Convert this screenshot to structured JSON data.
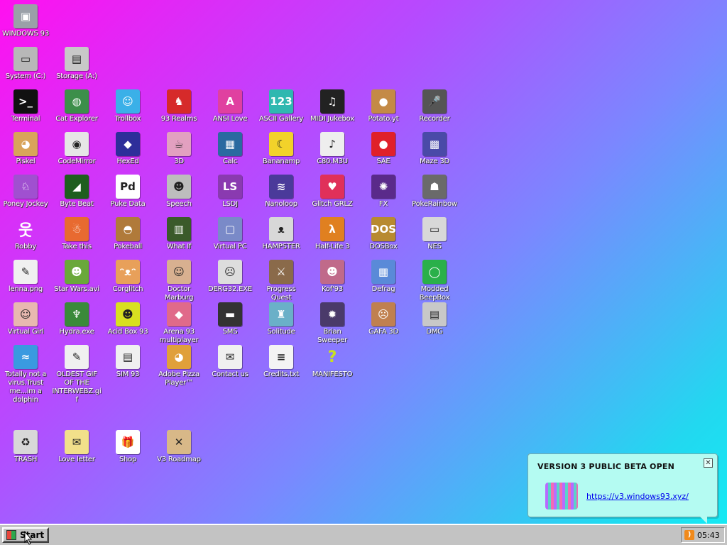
{
  "desktop": {
    "icons": [
      {
        "label": "WINDOWS 93",
        "glyph": "monitor-icon",
        "symbol": "▣",
        "color": "#9aa0a8",
        "interactive": true
      },
      {
        "label": "System (C:)",
        "glyph": "drive-c-icon",
        "symbol": "▭",
        "color": "#b8b8b8",
        "interactive": true
      },
      {
        "label": "Storage (A:)",
        "glyph": "floppy-drive-icon",
        "symbol": "▤",
        "color": "#c8c8c8",
        "interactive": true
      },
      {
        "label": "Terminal",
        "glyph": "terminal-icon",
        "symbol": ">_",
        "color": "#111111",
        "interactive": true
      },
      {
        "label": "Cat Explorer",
        "glyph": "cat-globe-icon",
        "symbol": "◍",
        "color": "#3c8f4a",
        "interactive": true
      },
      {
        "label": "Trollbox",
        "glyph": "chat-bubble-icon",
        "symbol": "☺",
        "color": "#3ab0e8",
        "interactive": true
      },
      {
        "label": "93 Realms",
        "glyph": "realms-icon",
        "symbol": "♞",
        "color": "#d62a2a",
        "interactive": true
      },
      {
        "label": "ANSI Love",
        "glyph": "ansi-love-icon",
        "symbol": "A",
        "color": "#e040a0",
        "interactive": true
      },
      {
        "label": "ASCII Gallery",
        "glyph": "ascii-gallery-icon",
        "symbol": "123",
        "color": "#2fb8b0",
        "interactive": true
      },
      {
        "label": "MIDI Jukebox",
        "glyph": "piano-keys-icon",
        "symbol": "♫",
        "color": "#222222",
        "interactive": true
      },
      {
        "label": "Potato.yt",
        "glyph": "potato-icon",
        "symbol": "●",
        "color": "#c48a46",
        "interactive": true
      },
      {
        "label": "Recorder",
        "glyph": "microphone-icon",
        "symbol": "🎤",
        "color": "#555555",
        "interactive": true
      },
      {
        "label": "Piskel",
        "glyph": "palette-icon",
        "symbol": "◕",
        "color": "#d9a45a",
        "interactive": true
      },
      {
        "label": "CodeMirror",
        "glyph": "codemirror-icon",
        "symbol": "◉",
        "color": "#e6e6e6",
        "interactive": true
      },
      {
        "label": "HexEd",
        "glyph": "hex-cube-icon",
        "symbol": "◆",
        "color": "#2e2e9a",
        "interactive": true
      },
      {
        "label": "3D",
        "glyph": "teapot-icon",
        "symbol": "☕",
        "color": "#e2a0c0",
        "interactive": true
      },
      {
        "label": "Calc",
        "glyph": "calculator-icon",
        "symbol": "▦",
        "color": "#2a6aa0",
        "interactive": true
      },
      {
        "label": "Bananamp",
        "glyph": "banana-icon",
        "symbol": "☾",
        "color": "#f2d22a",
        "interactive": true
      },
      {
        "label": "C80.M3U",
        "glyph": "audio-file-icon",
        "symbol": "♪",
        "color": "#eeeeee",
        "interactive": true
      },
      {
        "label": "SAE",
        "glyph": "amiga-ball-icon",
        "symbol": "●",
        "color": "#e0202a",
        "interactive": true
      },
      {
        "label": "Maze 3D",
        "glyph": "maze-icon",
        "symbol": "▩",
        "color": "#4a4aa8",
        "interactive": true
      },
      {
        "label": "Poney Jockey",
        "glyph": "pony-icon",
        "symbol": "♘",
        "color": "#a050d0",
        "interactive": true
      },
      {
        "label": "Byte Beat",
        "glyph": "bytebeat-icon",
        "symbol": "◢",
        "color": "#1e5e1e",
        "interactive": true
      },
      {
        "label": "Puke Data",
        "glyph": "puredata-icon",
        "symbol": "Pd",
        "color": "#ffffff",
        "interactive": true
      },
      {
        "label": "Speech",
        "glyph": "speech-face-icon",
        "symbol": "☻",
        "color": "#bdbdbd",
        "interactive": true
      },
      {
        "label": "LSDJ",
        "glyph": "lsdj-icon",
        "symbol": "LS",
        "color": "#8a3ab0",
        "interactive": true
      },
      {
        "label": "Nanoloop",
        "glyph": "nanoloop-icon",
        "symbol": "≋",
        "color": "#4a3a9a",
        "interactive": true
      },
      {
        "label": "Glitch GRLZ",
        "glyph": "lips-icon",
        "symbol": "♥",
        "color": "#e0305a",
        "interactive": true
      },
      {
        "label": "FX",
        "glyph": "atom-icon",
        "symbol": "✺",
        "color": "#5a2a8a",
        "interactive": true
      },
      {
        "label": "PokeRainbow",
        "glyph": "poke-rainbow-icon",
        "symbol": "☗",
        "color": "#6a6a6a",
        "interactive": true
      },
      {
        "label": "Robby",
        "glyph": "stick-figure-icon",
        "symbol": "웃",
        "color": "transparent",
        "interactive": true
      },
      {
        "label": "Take this",
        "glyph": "old-man-icon",
        "symbol": "☃",
        "color": "#e86a30",
        "interactive": true
      },
      {
        "label": "Pokeball",
        "glyph": "pokeball-icon",
        "symbol": "◓",
        "color": "#b07a3a",
        "interactive": true
      },
      {
        "label": "What If",
        "glyph": "what-if-icon",
        "symbol": "▥",
        "color": "#3a5a2a",
        "interactive": true
      },
      {
        "label": "Virtual PC",
        "glyph": "virtual-pc-icon",
        "symbol": "▢",
        "color": "#7a8ac8",
        "interactive": true
      },
      {
        "label": "HAMPSTER",
        "glyph": "hamster-icon",
        "symbol": "ᴥ",
        "color": "#d8d8d8",
        "interactive": true
      },
      {
        "label": "Half-Life 3",
        "glyph": "lambda-icon",
        "symbol": "λ",
        "color": "#e08020",
        "interactive": true
      },
      {
        "label": "DOSBox",
        "glyph": "dosbox-icon",
        "symbol": "DOS",
        "color": "#b88a30",
        "interactive": true
      },
      {
        "label": "NES",
        "glyph": "nes-console-icon",
        "symbol": "▭",
        "color": "#d8d8d8",
        "interactive": true
      },
      {
        "label": "lenna.png",
        "glyph": "image-file-icon",
        "symbol": "✎",
        "color": "#f0f0f0",
        "interactive": true
      },
      {
        "label": "Star Wars.avi",
        "glyph": "yoda-icon",
        "symbol": "☻",
        "color": "#6aa83a",
        "interactive": true
      },
      {
        "label": "Corglitch",
        "glyph": "corgi-icon",
        "symbol": "ᵔᴥᵔ",
        "color": "#e8a05a",
        "interactive": true
      },
      {
        "label": "Doctor Marburg",
        "glyph": "doctor-icon",
        "symbol": "☺",
        "color": "#d8b090",
        "interactive": true
      },
      {
        "label": "DERG32.EXE",
        "glyph": "derg-monitor-icon",
        "symbol": "☹",
        "color": "#dddddd",
        "interactive": true
      },
      {
        "label": "Progress Quest",
        "glyph": "crossed-swords-icon",
        "symbol": "⚔",
        "color": "#8a6a4a",
        "interactive": true
      },
      {
        "label": "Kof'93",
        "glyph": "fighter-icon",
        "symbol": "☻",
        "color": "#c06a8a",
        "interactive": true
      },
      {
        "label": "Defrag",
        "glyph": "defrag-icon",
        "symbol": "▦",
        "color": "#5a8ad8",
        "interactive": true
      },
      {
        "label": "Modded BeepBox",
        "glyph": "green-ring-icon",
        "symbol": "◯",
        "color": "#2ab04a",
        "interactive": true
      },
      {
        "label": "Virtual Girl",
        "glyph": "virtual-girl-icon",
        "symbol": "☺",
        "color": "#e8b8b0",
        "interactive": true
      },
      {
        "label": "Hydra.exe",
        "glyph": "hydra-icon",
        "symbol": "♆",
        "color": "#3a8a3a",
        "interactive": true
      },
      {
        "label": "Acid Box 93",
        "glyph": "smiley-icon",
        "symbol": "☻",
        "color": "#d8e020",
        "interactive": true
      },
      {
        "label": "Arena 93 multiplayer",
        "glyph": "cube-icon",
        "symbol": "◆",
        "color": "#e06a8a",
        "interactive": true
      },
      {
        "label": "SMS",
        "glyph": "sms-console-icon",
        "symbol": "▬",
        "color": "#333333",
        "interactive": true
      },
      {
        "label": "Solitude",
        "glyph": "solitude-icon",
        "symbol": "♜",
        "color": "#6ab0c8",
        "interactive": true
      },
      {
        "label": "Brian Sweeper",
        "glyph": "mine-icon",
        "symbol": "✹",
        "color": "#4a3a6a",
        "interactive": true
      },
      {
        "label": "GAFA 3D",
        "glyph": "doom-face-icon",
        "symbol": "☹",
        "color": "#c08050",
        "interactive": true
      },
      {
        "label": "DMG",
        "glyph": "gameboy-icon",
        "symbol": "▤",
        "color": "#c8c8c8",
        "interactive": true
      },
      {
        "label": "Totally not a virus.Trust me...im a dolphin",
        "glyph": "dolphin-icon",
        "symbol": "≈",
        "color": "#3a9ae0",
        "interactive": true
      },
      {
        "label": "OLDEST GIF OF THE INTERWEBZ.gif",
        "glyph": "gif-file-icon",
        "symbol": "✎",
        "color": "#f0f0f0",
        "interactive": true
      },
      {
        "label": "SIM 93",
        "glyph": "sim-book-icon",
        "symbol": "▤",
        "color": "#f0f0f0",
        "interactive": true
      },
      {
        "label": "Adobe Pizza Player™",
        "glyph": "pizza-icon",
        "symbol": "◕",
        "color": "#e0a03a",
        "interactive": true
      },
      {
        "label": "Contact us",
        "glyph": "contact-icon",
        "symbol": "✉",
        "color": "#f0f0f0",
        "interactive": true
      },
      {
        "label": "Credits.txt",
        "glyph": "text-file-icon",
        "symbol": "≡",
        "color": "#f4f4f4",
        "interactive": true
      },
      {
        "label": "MANIFESTO",
        "glyph": "question-mark-icon",
        "symbol": "?",
        "color": "transparent",
        "interactive": true
      },
      {
        "label": "TRASH",
        "glyph": "recycle-bin-icon",
        "symbol": "♻",
        "color": "#d8d8d8",
        "interactive": true
      },
      {
        "label": "Love letter",
        "glyph": "envelope-icon",
        "symbol": "✉",
        "color": "#f2e08a",
        "interactive": true
      },
      {
        "label": "Shop",
        "glyph": "gift-icon",
        "symbol": "🎁",
        "color": "#ffffff",
        "interactive": true
      },
      {
        "label": "V3 Roadmap",
        "glyph": "map-icon",
        "symbol": "✕",
        "color": "#d8b888",
        "interactive": true
      }
    ]
  },
  "taskbar": {
    "start_label": "Start",
    "clock": "05:43"
  },
  "notification": {
    "title": "VERSION 3 PUBLIC BETA OPEN",
    "link": "https://v3.windows93.xyz/",
    "close_symbol": "✕"
  }
}
